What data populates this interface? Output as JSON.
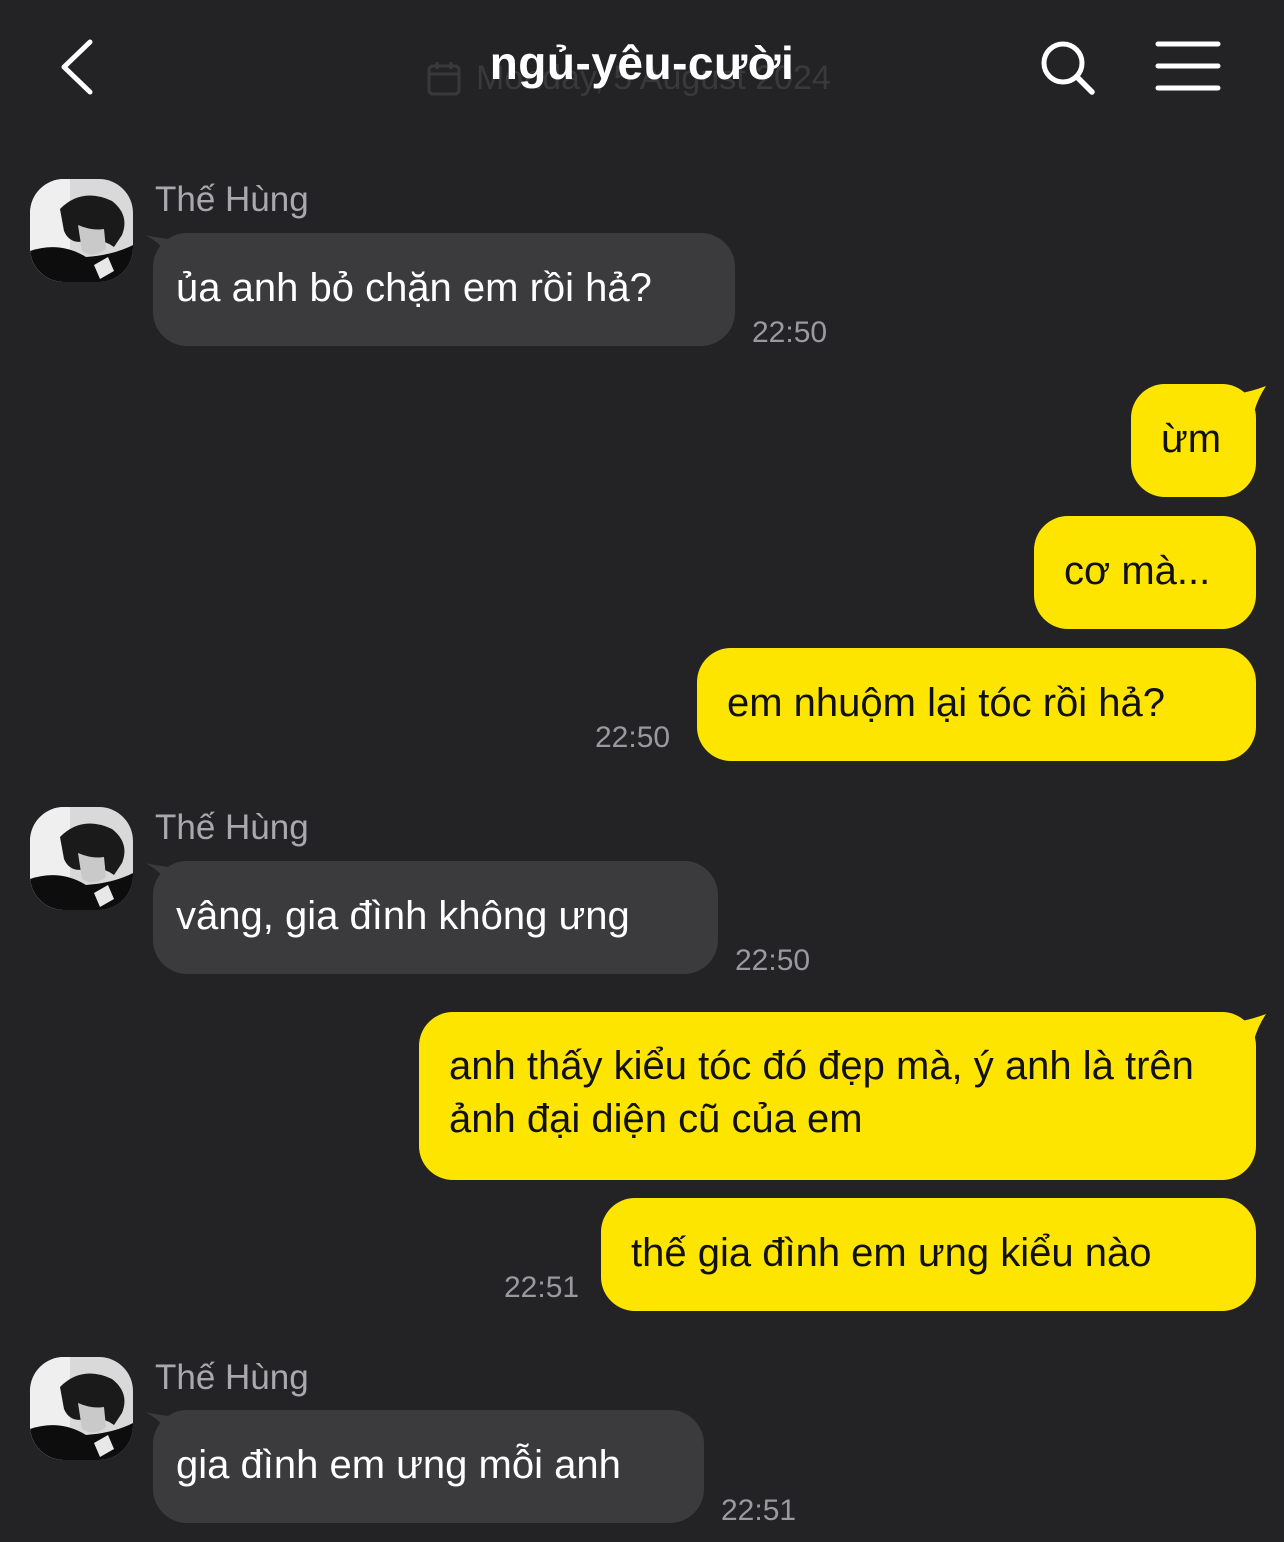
{
  "header": {
    "title": "ngủ-yêu-cười",
    "ghost_date": "Monday, 5 August 2024"
  },
  "colors": {
    "background": "#232325",
    "incoming_bubble": "#3b3b3e",
    "outgoing_bubble": "#fee500"
  },
  "messages": [
    {
      "sender": "Thế Hùng",
      "text": "ủa anh bỏ chặn em rồi hả?",
      "time": "22:50"
    },
    {
      "text": "ừm"
    },
    {
      "text": "cơ mà..."
    },
    {
      "text": "em nhuộm lại tóc rồi hả?",
      "time": "22:50"
    },
    {
      "sender": "Thế Hùng",
      "text": "vâng, gia đình không ưng",
      "time": "22:50"
    },
    {
      "text": "anh thấy kiểu tóc đó đẹp mà, ý anh là trên ảnh đại diện cũ của em"
    },
    {
      "text": "thế gia đình em ưng kiểu nào",
      "time": "22:51"
    },
    {
      "sender": "Thế Hùng",
      "text": "gia đình em ưng mỗi anh",
      "time": "22:51"
    }
  ]
}
